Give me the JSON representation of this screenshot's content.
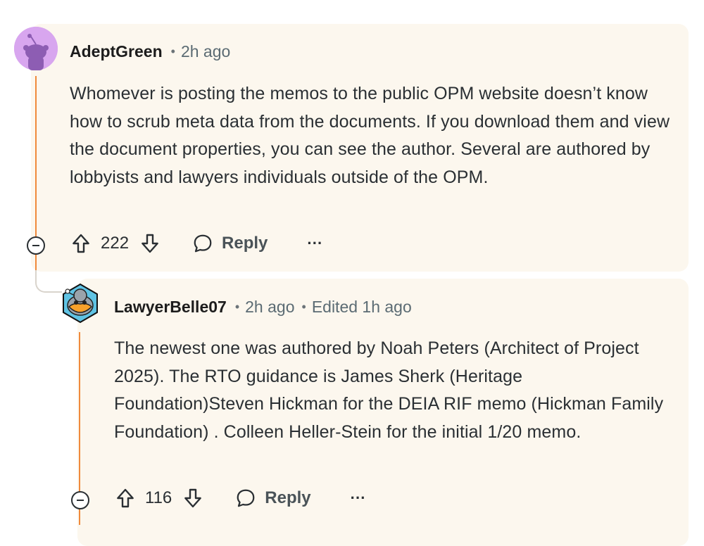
{
  "comments": [
    {
      "username": "AdeptGreen",
      "time": "2h ago",
      "edited": "",
      "body": "Whomever is posting the memos to the public OPM website doesn’t know how to scrub meta data from the documents. If you download them and view the document properties, you can see the author. Several are authored by lobbyists and lawyers individuals outside of the OPM.",
      "votes": "222",
      "reply_label": "Reply",
      "more_label": "···"
    },
    {
      "username": "LawyerBelle07",
      "time": "2h ago",
      "edited": "Edited 1h ago",
      "body": "The newest one was authored by Noah Peters (Architect of Project 2025). The RTO guidance is James Sherk (Heritage Foundation)Steven Hickman for the DEIA RIF memo (Hickman Family Foundation) . Colleen Heller-Stein for the initial 1/20 memo.",
      "votes": "116",
      "reply_label": "Reply",
      "more_label": "···"
    }
  ],
  "colors": {
    "card_bg": "#fcf7ee",
    "thread_line": "#f08a3c",
    "avatar_1": "#d8a6ef"
  },
  "icons": [
    "upvote-icon",
    "downvote-icon",
    "reply-bubble-icon",
    "collapse-icon",
    "more-options-icon",
    "snoo-avatar-icon"
  ]
}
